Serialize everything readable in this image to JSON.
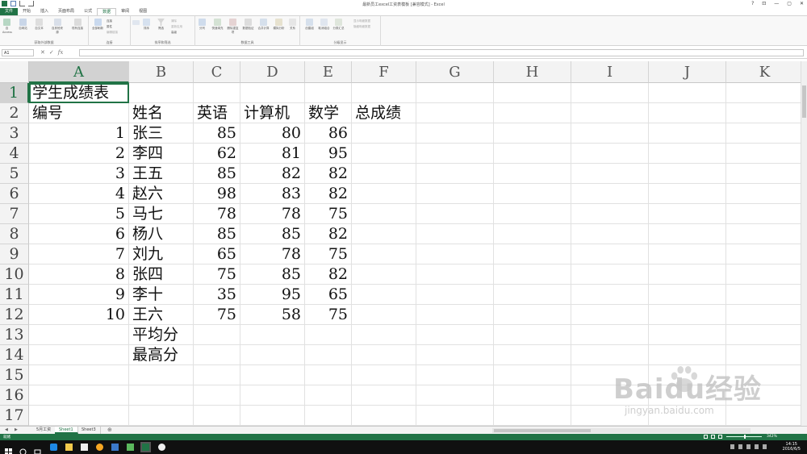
{
  "window": {
    "title": "最新员工excel工资表模板 [兼容模式] - Excel",
    "controls": [
      "?",
      "⊡",
      "—",
      "▢",
      "✕"
    ]
  },
  "ribbon": {
    "tabs": [
      "文件",
      "开始",
      "插入",
      "页面布局",
      "公式",
      "数据",
      "审阅",
      "视图"
    ],
    "active_tab": "数据",
    "groups": [
      {
        "label": "获取外部数据",
        "items": [
          "自 Access",
          "自网站",
          "自文本",
          "自其他来源",
          "现有连接"
        ]
      },
      {
        "label": "连接",
        "items": [
          "全部刷新",
          "连接",
          "属性",
          "编辑链接"
        ]
      },
      {
        "label": "排序和筛选",
        "items": [
          "排序",
          "筛选",
          "清除",
          "重新应用",
          "高级"
        ]
      },
      {
        "label": "数据工具",
        "items": [
          "分列",
          "快速填充",
          "删除重复项",
          "数据验证",
          "合并计算",
          "模拟分析",
          "关系"
        ]
      },
      {
        "label": "分级显示",
        "items": [
          "创建组",
          "取消组合",
          "分类汇总",
          "显示明细数据",
          "隐藏明细数据"
        ]
      }
    ]
  },
  "formula_bar": {
    "name_box": "A1",
    "icons": [
      "✕",
      "✓",
      "fx"
    ],
    "value": ""
  },
  "grid": {
    "columns": [
      "A",
      "B",
      "C",
      "D",
      "E",
      "F",
      "G",
      "H",
      "I",
      "J",
      "K"
    ],
    "rows": [
      "1",
      "2",
      "3",
      "4",
      "5",
      "6",
      "7",
      "8",
      "9",
      "10",
      "11",
      "12",
      "13",
      "14",
      "15",
      "16",
      "17"
    ],
    "selected_column": "A",
    "selected_row": "1",
    "cells": {
      "A1": "学生成绩表",
      "A2": "编号",
      "B2": "姓名",
      "C2": "英语",
      "D2": "计算机",
      "E2": "数学",
      "F2": "总成绩",
      "A3": "1",
      "B3": "张三",
      "C3": "85",
      "D3": "80",
      "E3": "86",
      "A4": "2",
      "B4": "李四",
      "C4": "62",
      "D4": "81",
      "E4": "95",
      "A5": "3",
      "B5": "王五",
      "C5": "85",
      "D5": "82",
      "E5": "82",
      "A6": "4",
      "B6": "赵六",
      "C6": "98",
      "D6": "83",
      "E6": "82",
      "A7": "5",
      "B7": "马七",
      "C7": "78",
      "D7": "78",
      "E7": "75",
      "A8": "6",
      "B8": "杨八",
      "C8": "85",
      "D8": "85",
      "E8": "82",
      "A9": "7",
      "B9": "刘九",
      "C9": "65",
      "D9": "78",
      "E9": "75",
      "A10": "8",
      "B10": "张四",
      "C10": "75",
      "D10": "85",
      "E10": "82",
      "A11": "9",
      "B11": "李十",
      "C11": "35",
      "D11": "95",
      "E11": "65",
      "A12": "10",
      "B12": "王六",
      "C12": "75",
      "D12": "58",
      "E12": "75",
      "B13": "平均分",
      "B14": "最高分"
    }
  },
  "sheets": {
    "tabs": [
      "5月工资",
      "Sheet1",
      "Sheet3"
    ],
    "active": "Sheet1",
    "add_label": "⊕"
  },
  "status": {
    "text": "就绪",
    "zoom": "342%"
  },
  "taskbar": {
    "time": "14:15",
    "date": "2016/6/5"
  },
  "watermark": {
    "brand": "Baidu经验",
    "url": "jingyan.baidu.com"
  },
  "colors": {
    "excel_green": "#217346",
    "header_gray": "#f3f3f3",
    "gridline": "#e1e1e1"
  }
}
